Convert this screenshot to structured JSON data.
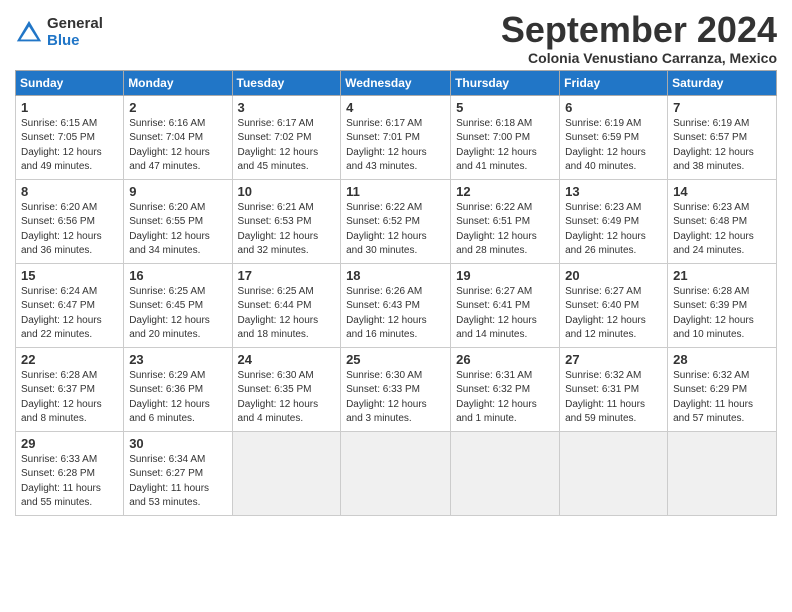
{
  "logo": {
    "general": "General",
    "blue": "Blue"
  },
  "title": "September 2024",
  "subtitle": "Colonia Venustiano Carranza, Mexico",
  "days_header": [
    "Sunday",
    "Monday",
    "Tuesday",
    "Wednesday",
    "Thursday",
    "Friday",
    "Saturday"
  ],
  "weeks": [
    [
      {
        "day": "1",
        "info": "Sunrise: 6:15 AM\nSunset: 7:05 PM\nDaylight: 12 hours\nand 49 minutes."
      },
      {
        "day": "2",
        "info": "Sunrise: 6:16 AM\nSunset: 7:04 PM\nDaylight: 12 hours\nand 47 minutes."
      },
      {
        "day": "3",
        "info": "Sunrise: 6:17 AM\nSunset: 7:02 PM\nDaylight: 12 hours\nand 45 minutes."
      },
      {
        "day": "4",
        "info": "Sunrise: 6:17 AM\nSunset: 7:01 PM\nDaylight: 12 hours\nand 43 minutes."
      },
      {
        "day": "5",
        "info": "Sunrise: 6:18 AM\nSunset: 7:00 PM\nDaylight: 12 hours\nand 41 minutes."
      },
      {
        "day": "6",
        "info": "Sunrise: 6:19 AM\nSunset: 6:59 PM\nDaylight: 12 hours\nand 40 minutes."
      },
      {
        "day": "7",
        "info": "Sunrise: 6:19 AM\nSunset: 6:57 PM\nDaylight: 12 hours\nand 38 minutes."
      }
    ],
    [
      {
        "day": "8",
        "info": "Sunrise: 6:20 AM\nSunset: 6:56 PM\nDaylight: 12 hours\nand 36 minutes."
      },
      {
        "day": "9",
        "info": "Sunrise: 6:20 AM\nSunset: 6:55 PM\nDaylight: 12 hours\nand 34 minutes."
      },
      {
        "day": "10",
        "info": "Sunrise: 6:21 AM\nSunset: 6:53 PM\nDaylight: 12 hours\nand 32 minutes."
      },
      {
        "day": "11",
        "info": "Sunrise: 6:22 AM\nSunset: 6:52 PM\nDaylight: 12 hours\nand 30 minutes."
      },
      {
        "day": "12",
        "info": "Sunrise: 6:22 AM\nSunset: 6:51 PM\nDaylight: 12 hours\nand 28 minutes."
      },
      {
        "day": "13",
        "info": "Sunrise: 6:23 AM\nSunset: 6:49 PM\nDaylight: 12 hours\nand 26 minutes."
      },
      {
        "day": "14",
        "info": "Sunrise: 6:23 AM\nSunset: 6:48 PM\nDaylight: 12 hours\nand 24 minutes."
      }
    ],
    [
      {
        "day": "15",
        "info": "Sunrise: 6:24 AM\nSunset: 6:47 PM\nDaylight: 12 hours\nand 22 minutes."
      },
      {
        "day": "16",
        "info": "Sunrise: 6:25 AM\nSunset: 6:45 PM\nDaylight: 12 hours\nand 20 minutes."
      },
      {
        "day": "17",
        "info": "Sunrise: 6:25 AM\nSunset: 6:44 PM\nDaylight: 12 hours\nand 18 minutes."
      },
      {
        "day": "18",
        "info": "Sunrise: 6:26 AM\nSunset: 6:43 PM\nDaylight: 12 hours\nand 16 minutes."
      },
      {
        "day": "19",
        "info": "Sunrise: 6:27 AM\nSunset: 6:41 PM\nDaylight: 12 hours\nand 14 minutes."
      },
      {
        "day": "20",
        "info": "Sunrise: 6:27 AM\nSunset: 6:40 PM\nDaylight: 12 hours\nand 12 minutes."
      },
      {
        "day": "21",
        "info": "Sunrise: 6:28 AM\nSunset: 6:39 PM\nDaylight: 12 hours\nand 10 minutes."
      }
    ],
    [
      {
        "day": "22",
        "info": "Sunrise: 6:28 AM\nSunset: 6:37 PM\nDaylight: 12 hours\nand 8 minutes."
      },
      {
        "day": "23",
        "info": "Sunrise: 6:29 AM\nSunset: 6:36 PM\nDaylight: 12 hours\nand 6 minutes."
      },
      {
        "day": "24",
        "info": "Sunrise: 6:30 AM\nSunset: 6:35 PM\nDaylight: 12 hours\nand 4 minutes."
      },
      {
        "day": "25",
        "info": "Sunrise: 6:30 AM\nSunset: 6:33 PM\nDaylight: 12 hours\nand 3 minutes."
      },
      {
        "day": "26",
        "info": "Sunrise: 6:31 AM\nSunset: 6:32 PM\nDaylight: 12 hours\nand 1 minute."
      },
      {
        "day": "27",
        "info": "Sunrise: 6:32 AM\nSunset: 6:31 PM\nDaylight: 11 hours\nand 59 minutes."
      },
      {
        "day": "28",
        "info": "Sunrise: 6:32 AM\nSunset: 6:29 PM\nDaylight: 11 hours\nand 57 minutes."
      }
    ],
    [
      {
        "day": "29",
        "info": "Sunrise: 6:33 AM\nSunset: 6:28 PM\nDaylight: 11 hours\nand 55 minutes."
      },
      {
        "day": "30",
        "info": "Sunrise: 6:34 AM\nSunset: 6:27 PM\nDaylight: 11 hours\nand 53 minutes."
      },
      null,
      null,
      null,
      null,
      null
    ]
  ]
}
